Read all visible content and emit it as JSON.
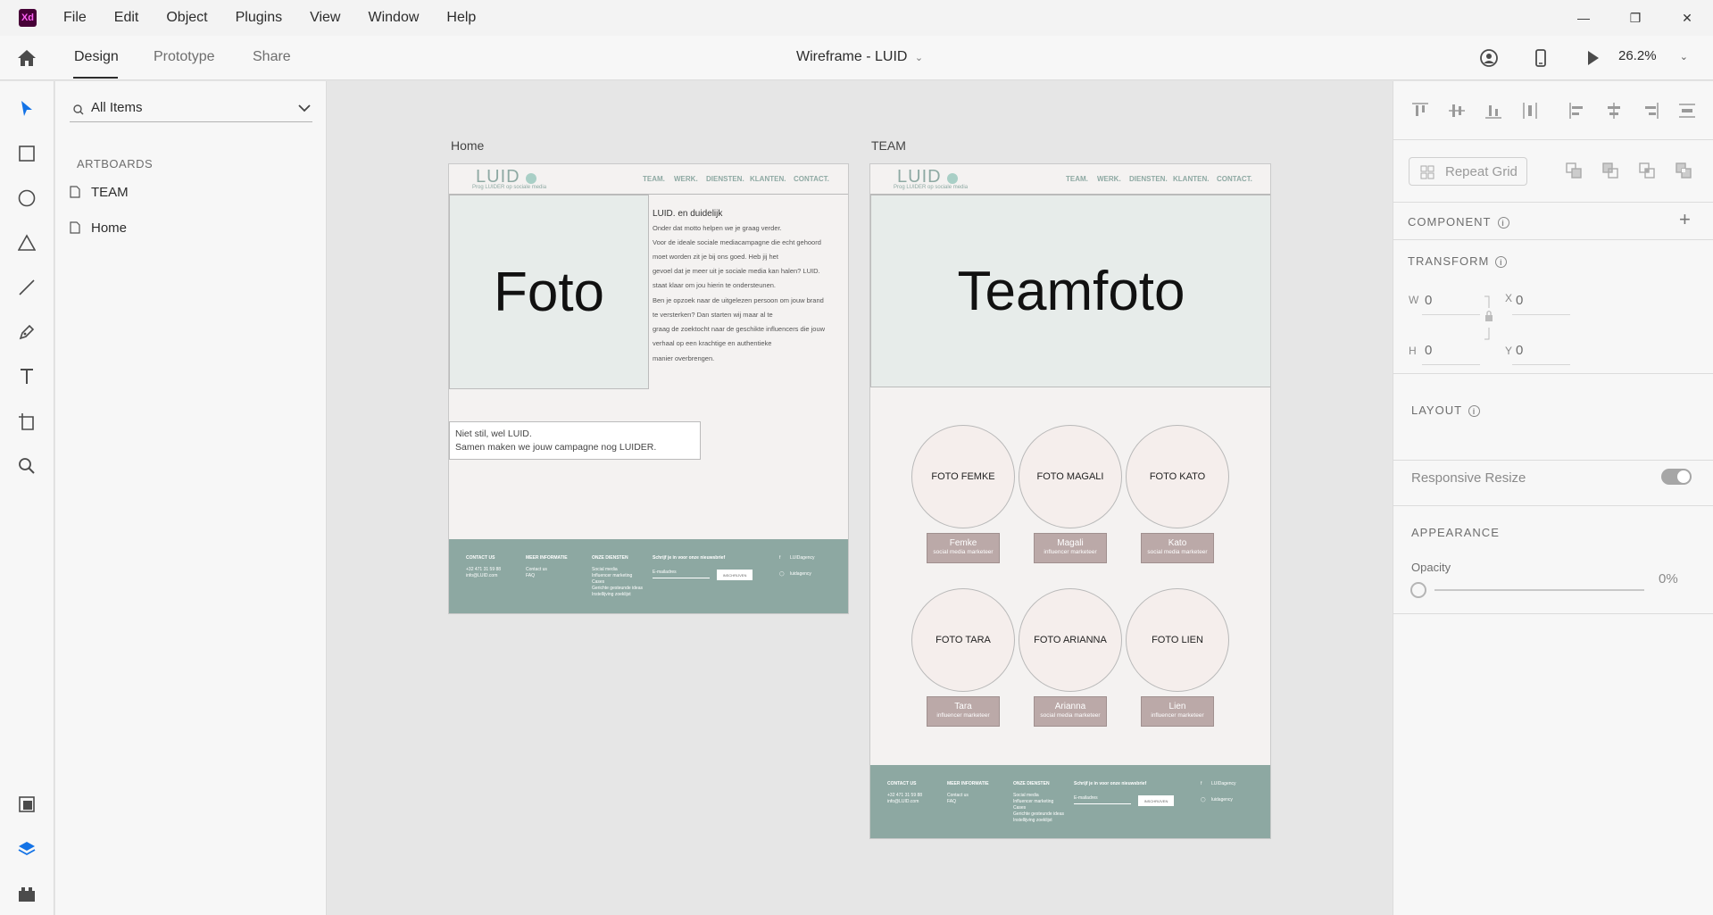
{
  "app": {
    "logo": "Xd"
  },
  "menu": [
    "File",
    "Edit",
    "Object",
    "Plugins",
    "View",
    "Window",
    "Help"
  ],
  "window_controls": {
    "minimize": "—",
    "restore": "❐",
    "close": "✕"
  },
  "toolbar": {
    "tabs": [
      "Design",
      "Prototype",
      "Share"
    ],
    "active_tab": "Design",
    "document_title": "Wireframe - LUID",
    "zoom": "26.2%"
  },
  "layers": {
    "search_placeholder": "All Items",
    "section": "ARTBOARDS",
    "artboards": [
      "TEAM",
      "Home"
    ]
  },
  "canvas": {
    "home": {
      "label": "Home",
      "logo": "LUID",
      "logo_tagline": "Prog LUIDER op sociale media",
      "nav": [
        "TEAM.",
        "WERK.",
        "DIENSTEN.",
        "KLANTEN.",
        "CONTACT."
      ],
      "photo": "Foto",
      "intro_title": "LUID. en duidelijk",
      "intro_lines": [
        "Onder dat motto helpen we je graag verder.",
        "Voor de ideale sociale mediacampagne die echt gehoord",
        "moet worden zit je bij ons goed. Heb jij het",
        "gevoel dat je meer uit je sociale media kan halen? LUID.",
        "staat klaar om jou hierin te ondersteunen.",
        "Ben je opzoek naar de uitgelezen persoon om jouw brand",
        "te versterken? Dan starten wij maar al te",
        "graag de zoektocht naar de geschikte influencers die jouw",
        "verhaal op een krachtige en authentieke",
        "manier overbrengen."
      ],
      "slogan_1": "Niet stil, wel LUID.",
      "slogan_2": "Samen maken we jouw campagne nog LUIDER."
    },
    "team": {
      "label": "TEAM",
      "photo": "Teamfoto",
      "members": [
        {
          "photo": "FOTO FEMKE",
          "name": "Femke",
          "role": "social media marketeer"
        },
        {
          "photo": "FOTO MAGALI",
          "name": "Magali",
          "role": "influencer marketeer"
        },
        {
          "photo": "FOTO KATO",
          "name": "Kato",
          "role": "social media marketeer"
        },
        {
          "photo": "FOTO TARA",
          "name": "Tara",
          "role": "influencer marketeer"
        },
        {
          "photo": "FOTO ARIANNA",
          "name": "Arianna",
          "role": "social media marketeer"
        },
        {
          "photo": "FOTO LIEN",
          "name": "Lien",
          "role": "influencer marketeer"
        }
      ]
    },
    "footer": {
      "col1_title": "CONTACT US",
      "col1_lines": [
        "+32 471 31 59 88",
        "info@LUID.com"
      ],
      "col2_title": "MEER INFORMATIE",
      "col2_lines": [
        "Contact us",
        "FAQ"
      ],
      "col3_title": "ONZE DIENSTEN",
      "col3_lines": [
        "Social media",
        "Influencer marketing",
        "Cases",
        "Gerichte gesteunde ideas",
        "Instellijving zoeklijst"
      ],
      "newsletter_title": "Schrijf je in voor onze nieuwsbrief",
      "newsletter_input": "E-mailadres",
      "newsletter_button": "INSCHRIJVEN",
      "social_1": "LUIDagency",
      "social_2": "luidagency"
    }
  },
  "inspector": {
    "repeat_grid": "Repeat Grid",
    "component_title": "COMPONENT",
    "transform_title": "TRANSFORM",
    "w_label": "W",
    "w_value": "0",
    "h_label": "H",
    "h_value": "0",
    "x_label": "X",
    "x_value": "0",
    "y_label": "Y",
    "y_value": "0",
    "layout_title": "LAYOUT",
    "responsive_resize": "Responsive Resize",
    "responsive_resize_on": true,
    "appearance_title": "APPEARANCE",
    "opacity_label": "Opacity",
    "opacity_value": "0%"
  },
  "colors": {
    "footer_green": "#8da8a2",
    "name_tag": "#bba9a8",
    "accent_blue": "#1473e6",
    "xd_logo_bg": "#470137"
  }
}
